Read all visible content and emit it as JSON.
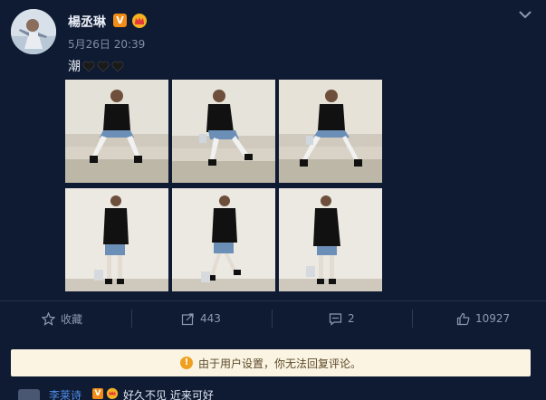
{
  "post": {
    "username": "楊丞琳",
    "verified_badge": "V",
    "timestamp": "5月26日 20:39",
    "text": "潮",
    "heart_count_visual": 3,
    "heart_color": "#000000"
  },
  "photos": {
    "count": 6,
    "grid": "3x2"
  },
  "actions": {
    "favorite_label": "收藏",
    "share_count": "443",
    "comment_count": "2",
    "like_count": "10927"
  },
  "notice": {
    "text": "由于用户设置，你无法回复评论。"
  },
  "comment": {
    "username": "李莱诗",
    "verified_badge": "V",
    "text": "好久不见 近来可好"
  },
  "colors": {
    "background": "#0f1b33",
    "verified": "#f28c17",
    "link": "#4f8ee8",
    "notice_bg": "#fbf4e2"
  }
}
